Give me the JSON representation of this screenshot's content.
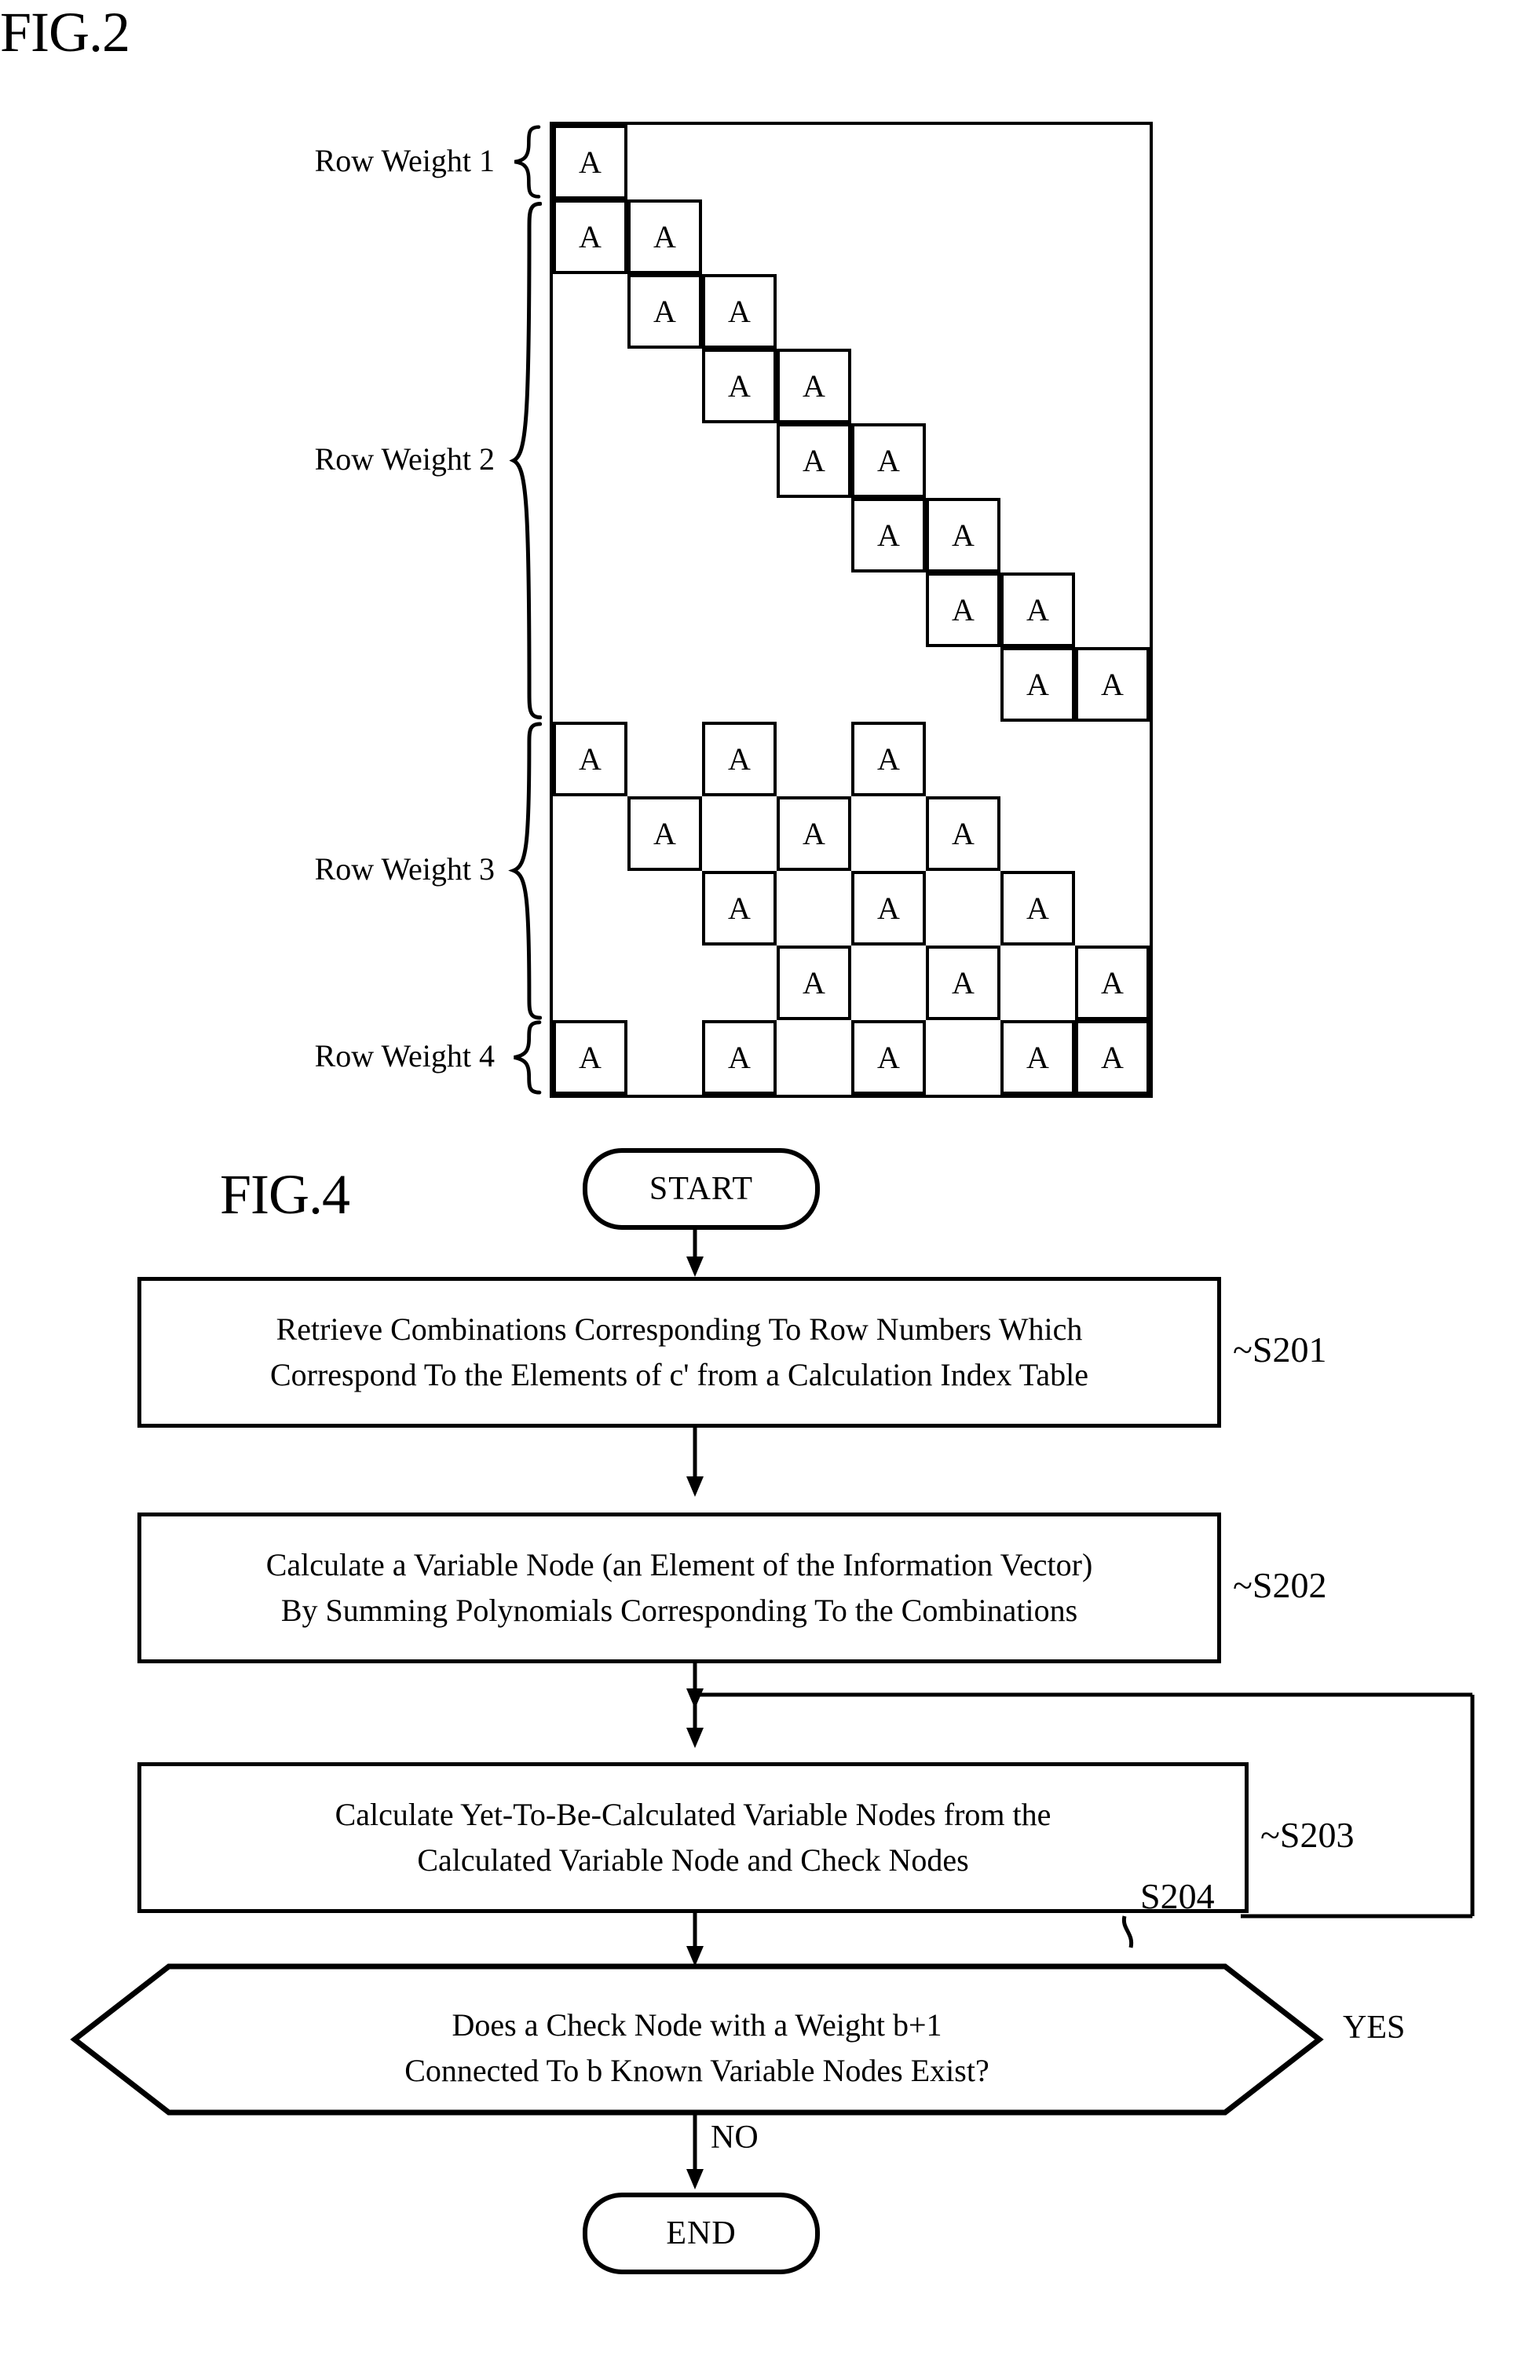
{
  "figures": {
    "fig2": {
      "label": "FIG.2",
      "row_group_labels": [
        "Row Weight 1",
        "Row Weight 2",
        "Row Weight 3",
        "Row Weight 4"
      ],
      "cell_symbol": "A",
      "matrix": {
        "rows": 13,
        "cols": 8,
        "row_groups": [
          {
            "name": "Row Weight 1",
            "row_indices": [
              0
            ]
          },
          {
            "name": "Row Weight 2",
            "row_indices": [
              1,
              2,
              3,
              4,
              5,
              6,
              7
            ]
          },
          {
            "name": "Row Weight 3",
            "row_indices": [
              8,
              9,
              10,
              11
            ]
          },
          {
            "name": "Row Weight 4",
            "row_indices": [
              12
            ]
          }
        ],
        "occupied": [
          [
            1,
            0,
            0,
            0,
            0,
            0,
            0,
            0
          ],
          [
            1,
            1,
            0,
            0,
            0,
            0,
            0,
            0
          ],
          [
            0,
            1,
            1,
            0,
            0,
            0,
            0,
            0
          ],
          [
            0,
            0,
            1,
            1,
            0,
            0,
            0,
            0
          ],
          [
            0,
            0,
            0,
            1,
            1,
            0,
            0,
            0
          ],
          [
            0,
            0,
            0,
            0,
            1,
            1,
            0,
            0
          ],
          [
            0,
            0,
            0,
            0,
            0,
            1,
            1,
            0
          ],
          [
            0,
            0,
            0,
            0,
            0,
            0,
            1,
            1
          ],
          [
            1,
            0,
            1,
            0,
            1,
            0,
            0,
            0
          ],
          [
            0,
            1,
            0,
            1,
            0,
            1,
            0,
            0
          ],
          [
            0,
            0,
            1,
            0,
            1,
            0,
            1,
            0
          ],
          [
            0,
            0,
            0,
            1,
            0,
            1,
            0,
            1
          ],
          [
            1,
            0,
            1,
            0,
            1,
            0,
            1,
            1
          ]
        ]
      }
    },
    "fig4": {
      "label": "FIG.4",
      "start_label": "START",
      "end_label": "END",
      "steps": [
        {
          "tag": "S201",
          "lines": [
            "Retrieve Combinations Corresponding To Row Numbers Which",
            "Correspond To the Elements of c' from a Calculation Index Table"
          ]
        },
        {
          "tag": "S202",
          "lines": [
            "Calculate a Variable Node (an Element of the Information Vector)",
            "By Summing Polynomials Corresponding To the Combinations"
          ]
        },
        {
          "tag": "S203",
          "lines": [
            "Calculate Yet-To-Be-Calculated Variable Nodes from the",
            "Calculated Variable Node and Check Nodes"
          ]
        }
      ],
      "decision": {
        "tag": "S204",
        "lines": [
          "Does a Check Node with a Weight b+1",
          "Connected To b Known Variable Nodes Exist?"
        ],
        "yes_label": "YES",
        "no_label": "NO"
      }
    }
  }
}
